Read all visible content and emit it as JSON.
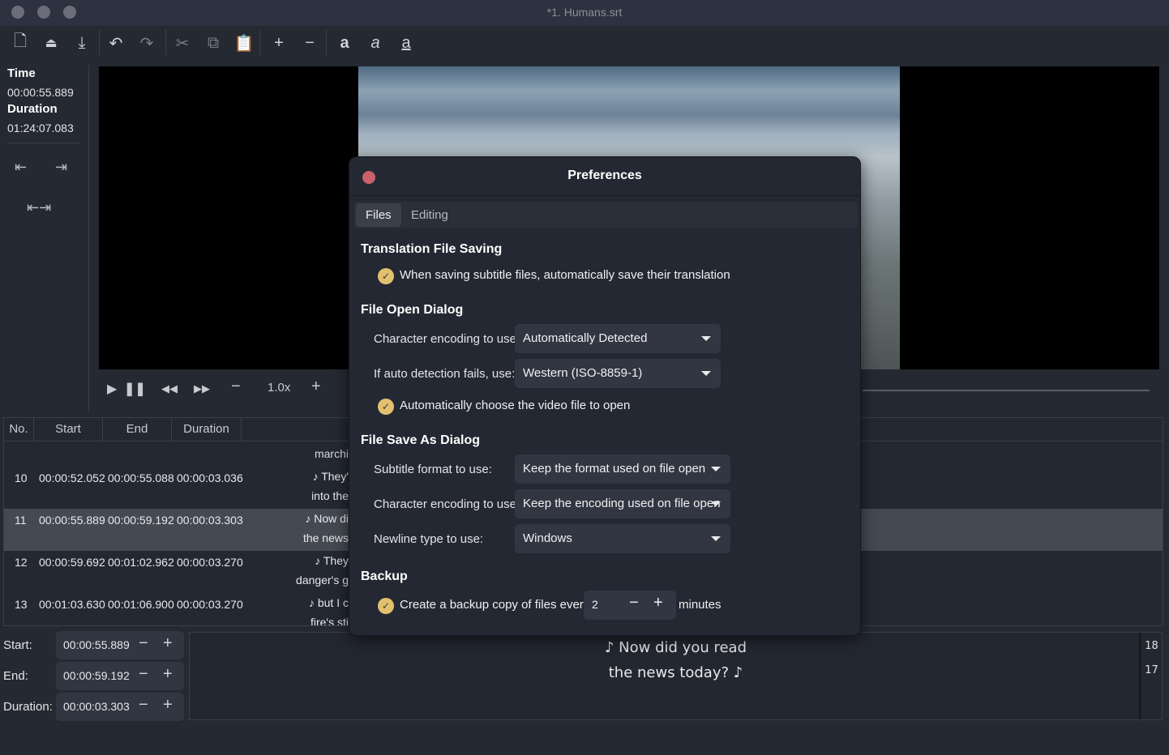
{
  "window": {
    "title": "*1. Humans.srt"
  },
  "toolbar": {
    "icons": [
      "new-file-icon",
      "open-icon",
      "save-icon",
      "undo-icon",
      "redo-icon",
      "cut-icon",
      "copy-icon",
      "paste-icon",
      "add-icon",
      "remove-icon",
      "bold-icon",
      "italic-icon",
      "underline-icon"
    ]
  },
  "info": {
    "time_label": "Time",
    "time": "00:00:55.889",
    "duration_label": "Duration",
    "duration": "01:24:07.083"
  },
  "player": {
    "speed": "1.0x"
  },
  "table": {
    "headers": [
      "No.",
      "Start",
      "End",
      "Duration"
    ],
    "partial_top": "marchi",
    "rows": [
      {
        "no": "10",
        "start": "00:00:52.052",
        "end": "00:00:55.088",
        "duration": "00:00:03.036",
        "line1": "♪ They'",
        "line2": "into the"
      },
      {
        "no": "11",
        "start": "00:00:55.889",
        "end": "00:00:59.192",
        "duration": "00:00:03.303",
        "line1": "♪ Now di",
        "line2": "the news",
        "selected": true
      },
      {
        "no": "12",
        "start": "00:00:59.692",
        "end": "00:01:02.962",
        "duration": "00:00:03.270",
        "line1": "♪ They",
        "line2": "danger's g"
      },
      {
        "no": "13",
        "start": "00:01:03.630",
        "end": "00:01:06.900",
        "duration": "00:00:03.270",
        "line1": "♪ but I c",
        "line2": "fire's sti"
      }
    ]
  },
  "editor": {
    "start_label": "Start:",
    "start": "00:00:55.889",
    "end_label": "End:",
    "end": "00:00:59.192",
    "duration_label": "Duration:",
    "duration": "00:00:03.303",
    "text_line1": "♪ Now did you read",
    "text_line2": "the news today? ♪",
    "count1": "18",
    "count2": "17"
  },
  "dialog": {
    "title": "Preferences",
    "tabs": [
      "Files",
      "Editing"
    ],
    "translation_heading": "Translation File Saving",
    "translation_check": "When saving subtitle files, automatically save their translation",
    "open_heading": "File Open Dialog",
    "open_enc_label": "Character encoding to use:",
    "open_enc_value": "Automatically Detected",
    "fallback_label": "If auto detection fails, use:",
    "fallback_value": "Western (ISO-8859-1)",
    "video_check": "Automatically choose the video file to open",
    "save_heading": "File Save As Dialog",
    "format_label": "Subtitle format to use:",
    "format_value": "Keep the format used on file open",
    "save_enc_label": "Character encoding to use:",
    "save_enc_value": "Keep the encoding used on file open",
    "newline_label": "Newline type to use:",
    "newline_value": "Windows",
    "backup_heading": "Backup",
    "backup_check": "Create a backup copy of files every",
    "backup_value": "2",
    "backup_unit": "minutes"
  },
  "colors": {
    "accent_check": "#e2c06f",
    "close": "#c9606a",
    "selected_row": "#454a52"
  }
}
